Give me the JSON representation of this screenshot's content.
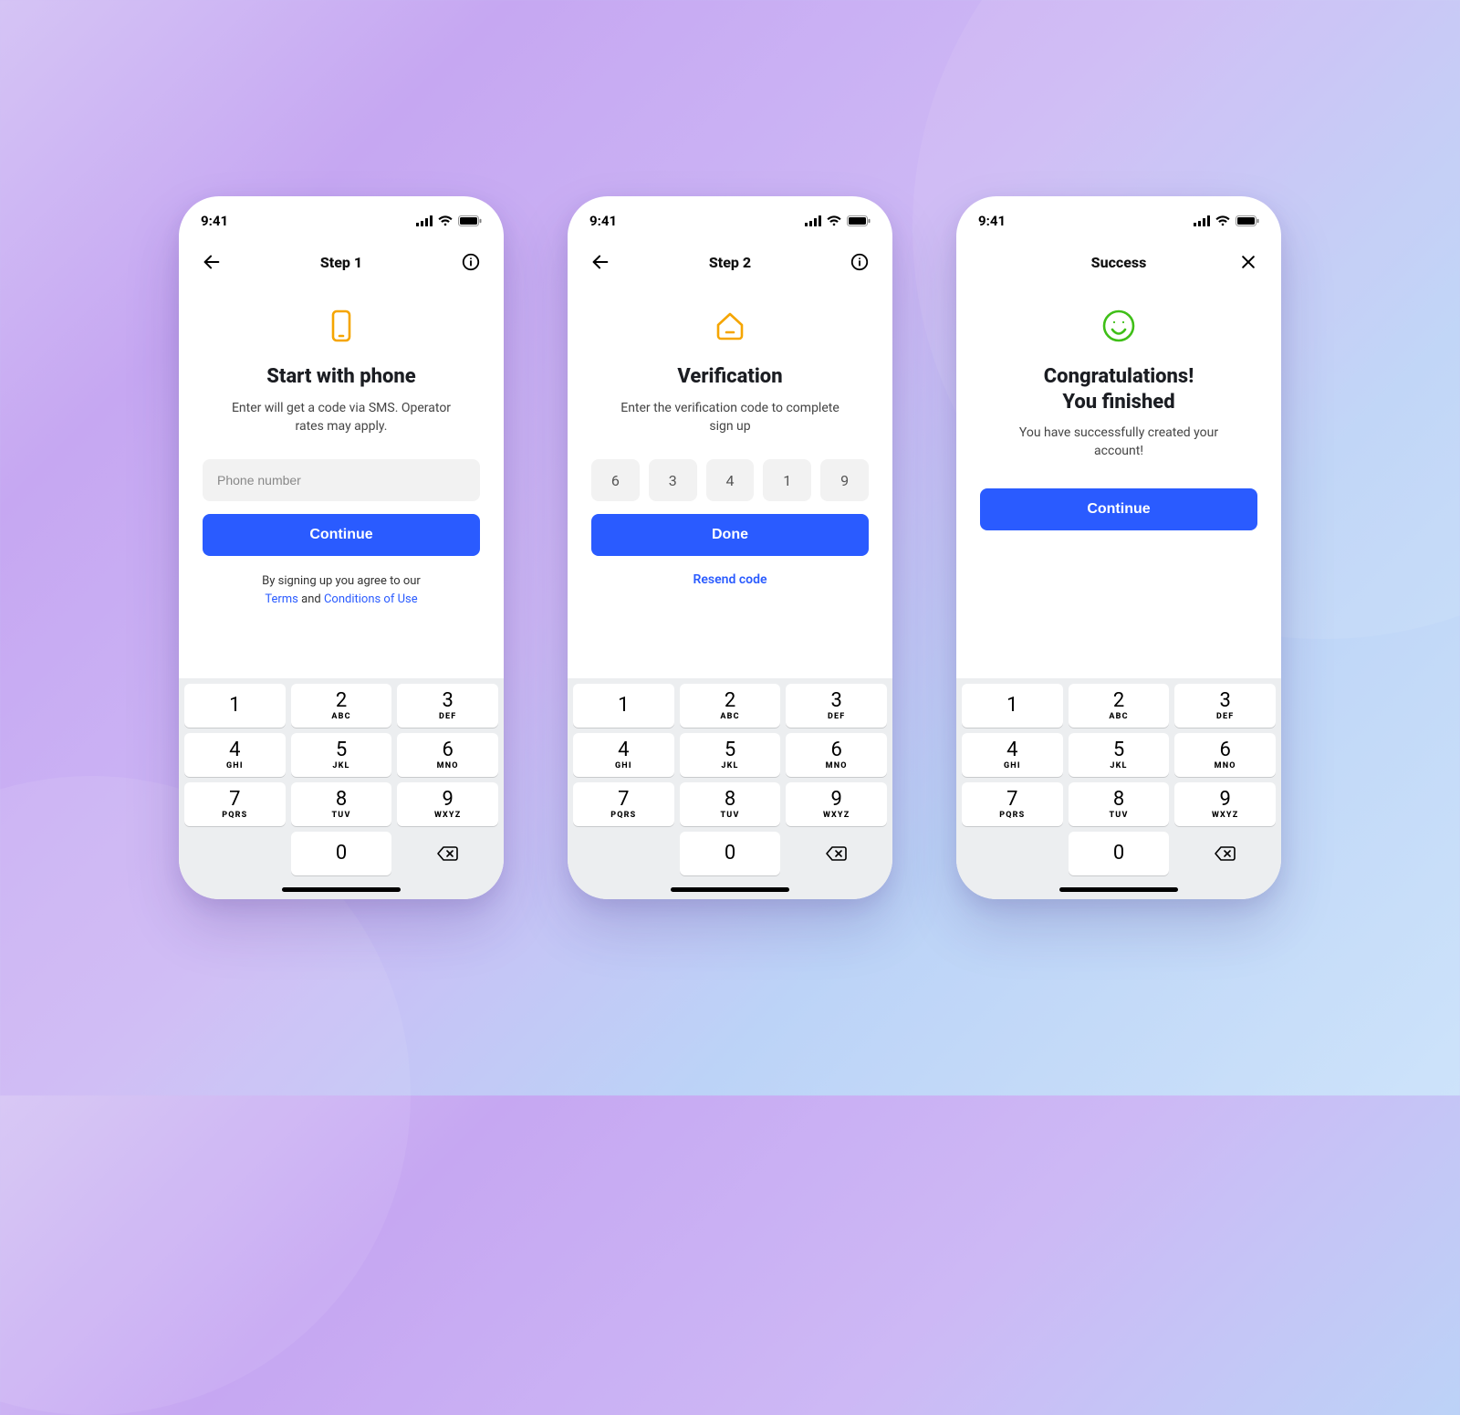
{
  "statusbar": {
    "time": "9:41"
  },
  "keypad": {
    "keys": [
      {
        "digit": "1",
        "letters": ""
      },
      {
        "digit": "2",
        "letters": "ABC"
      },
      {
        "digit": "3",
        "letters": "DEF"
      },
      {
        "digit": "4",
        "letters": "GHI"
      },
      {
        "digit": "5",
        "letters": "JKL"
      },
      {
        "digit": "6",
        "letters": "MNO"
      },
      {
        "digit": "7",
        "letters": "PQRS"
      },
      {
        "digit": "8",
        "letters": "TUV"
      },
      {
        "digit": "9",
        "letters": "WXYZ"
      },
      {
        "digit": "0",
        "letters": ""
      }
    ]
  },
  "screens": [
    {
      "nav_title": "Step 1",
      "heading": "Start with phone",
      "subtext": "Enter will get a code via SMS. Operator rates may apply.",
      "phone_placeholder": "Phone number",
      "button_label": "Continue",
      "legal_prefix": "By signing up you agree to our ",
      "terms_label": "Terms",
      "legal_mid": " and ",
      "conditions_label": "Conditions of Use"
    },
    {
      "nav_title": "Step 2",
      "heading": "Verification",
      "subtext": "Enter the verification code to complete sign up",
      "otp": [
        "6",
        "3",
        "4",
        "1",
        "9"
      ],
      "button_label": "Done",
      "resend_label": "Resend code"
    },
    {
      "nav_title": "Success",
      "heading_line1": "Congratulations!",
      "heading_line2": "You finished",
      "subtext": "You have successfully created your account!",
      "button_label": "Continue"
    }
  ]
}
